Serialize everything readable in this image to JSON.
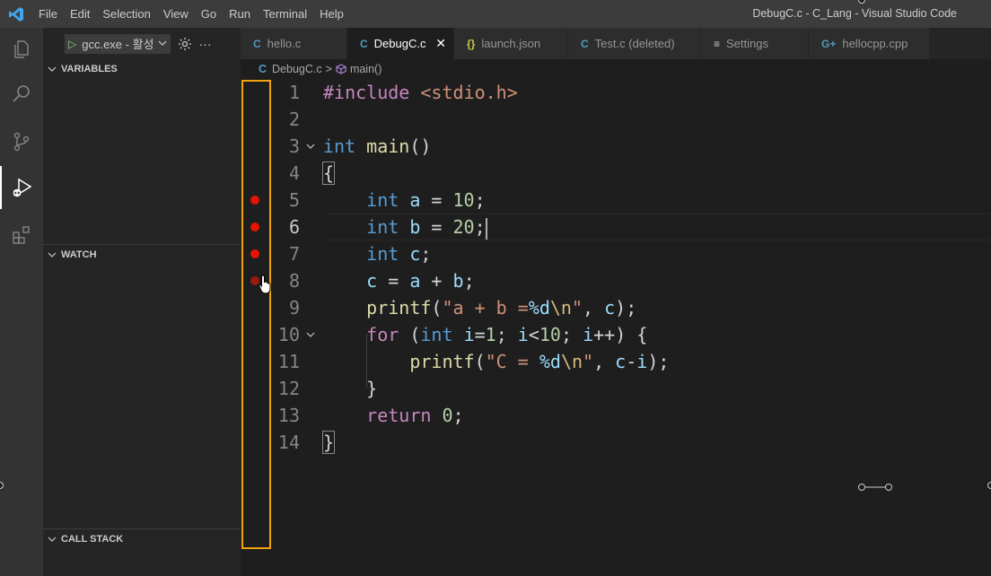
{
  "titlebar": {
    "menu": [
      "File",
      "Edit",
      "Selection",
      "View",
      "Go",
      "Run",
      "Terminal",
      "Help"
    ],
    "window_title": "DebugC.c - C_Lang - Visual Studio Code"
  },
  "activitybar": {
    "icons": [
      "explorer-icon",
      "search-icon",
      "source-control-icon",
      "run-debug-icon",
      "extensions-icon"
    ]
  },
  "sidebar": {
    "launch_config": "gcc.exe - 활성",
    "sections": {
      "variables": "VARIABLES",
      "watch": "WATCH",
      "call_stack": "CALL STACK"
    }
  },
  "tabs": [
    {
      "icon": "C",
      "label": "hello.c",
      "active": false
    },
    {
      "icon": "C",
      "label": "DebugC.c",
      "active": true
    },
    {
      "icon": "{}",
      "label": "launch.json",
      "active": false
    },
    {
      "icon": "C",
      "label": "Test.c (deleted)",
      "active": false
    },
    {
      "icon": "≡",
      "label": "Settings",
      "active": false
    },
    {
      "icon": "G+",
      "label": "hellocpp.cpp",
      "active": false
    }
  ],
  "breadcrumb": {
    "file_icon": "C",
    "file": "DebugC.c",
    "separator": ">",
    "symbol": "main()"
  },
  "editor": {
    "breakpoints_on_lines": [
      5,
      6,
      7,
      8
    ],
    "current_line": 6,
    "line_numbers": [
      "1",
      "2",
      "3",
      "4",
      "5",
      "6",
      "7",
      "8",
      "9",
      "10",
      "11",
      "12",
      "13",
      "14"
    ],
    "lines": [
      "#include <stdio.h>",
      "",
      "int main()",
      "{",
      "    int a = 10;",
      "    int b = 20;",
      "    int c;",
      "    c = a + b;",
      "    printf(\"a + b =%d\\n\", c);",
      "    for (int i=1; i<10; i++) {",
      "        printf(\"C = %d\\n\", c-i);",
      "    }",
      "    return 0;",
      "}"
    ]
  },
  "colors": {
    "breakpoint": "#e51400",
    "gutter_highlight": "#f0a30a",
    "accent": "#007acc"
  }
}
